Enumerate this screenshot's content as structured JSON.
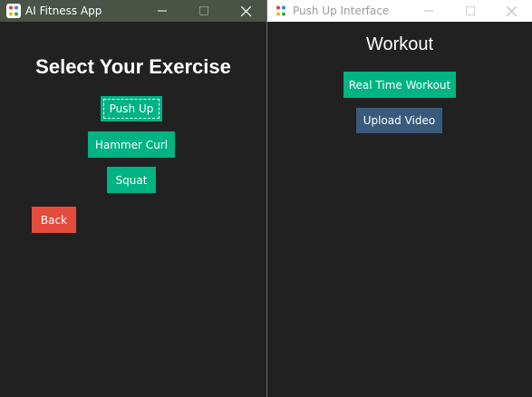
{
  "left_window": {
    "title": "AI Fitness App",
    "heading": "Select Your Exercise",
    "buttons": {
      "push_up": "Push Up",
      "hammer_curl": "Hammer Curl",
      "squat": "Squat",
      "back": "Back"
    }
  },
  "right_window": {
    "title": "Push Up Interface",
    "heading": "Workout",
    "buttons": {
      "real_time": "Real Time Workout",
      "upload": "Upload Video"
    }
  },
  "icons": {
    "app": "app-icon",
    "minimize": "minimize-icon",
    "maximize": "maximize-icon",
    "close": "close-icon"
  },
  "colors": {
    "background": "#212121",
    "green_button": "#00b383",
    "red_button": "#e34b3c",
    "blue_button": "#3a5a7c"
  }
}
